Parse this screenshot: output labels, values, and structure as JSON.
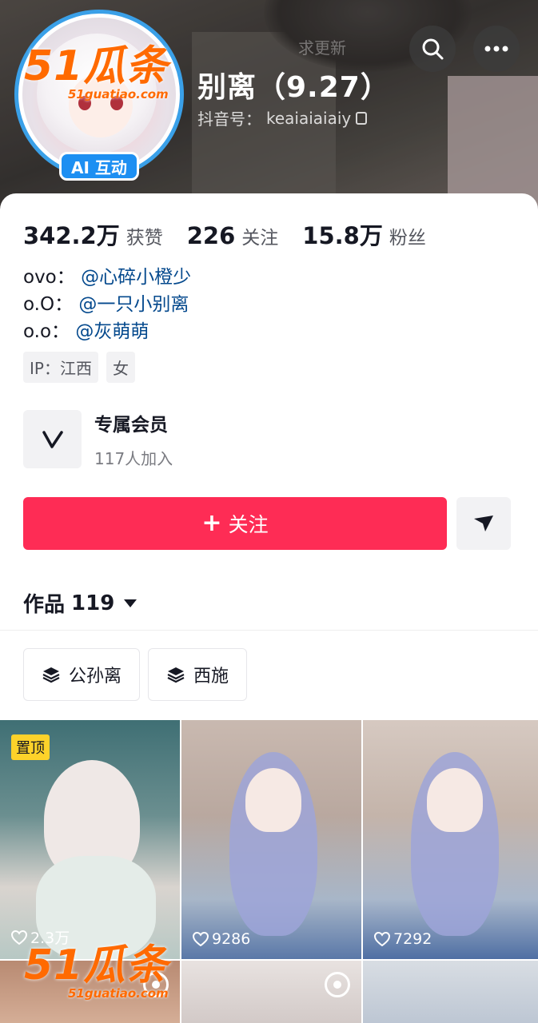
{
  "header": {
    "nickname": "别离（9.27）",
    "douyin_id_label": "抖音号：",
    "douyin_id": "keaiaiaiaiy",
    "ai_badge": "AI 互动",
    "faint_text": "求更新"
  },
  "stats": [
    {
      "value": "342.2万",
      "label": "获赞"
    },
    {
      "value": "226",
      "label": "关注"
    },
    {
      "value": "15.8万",
      "label": "粉丝"
    }
  ],
  "bio": [
    {
      "prefix": "ovo：",
      "mention": "@心碎小橙少"
    },
    {
      "prefix": "o.O：",
      "mention": "@一只小别离"
    },
    {
      "prefix": "o.o：",
      "mention": "@灰萌萌"
    }
  ],
  "tags": [
    "IP：江西",
    "女"
  ],
  "member": {
    "title": "专属会员",
    "subtitle": "117人加入"
  },
  "follow_label": "关注",
  "works": {
    "label": "作品",
    "count": "119"
  },
  "collections": [
    "公孙离",
    "西施"
  ],
  "videos": [
    {
      "pinned_label": "置顶",
      "likes": "2.3万"
    },
    {
      "likes": "9286"
    },
    {
      "likes": "7292"
    }
  ],
  "watermark": {
    "brand": "51瓜条",
    "url": "51guatiao.com"
  },
  "colors": {
    "accent": "#fe2c55",
    "mention": "#04498d",
    "badge": "#1d8ff2",
    "pin": "#fdd22a"
  }
}
